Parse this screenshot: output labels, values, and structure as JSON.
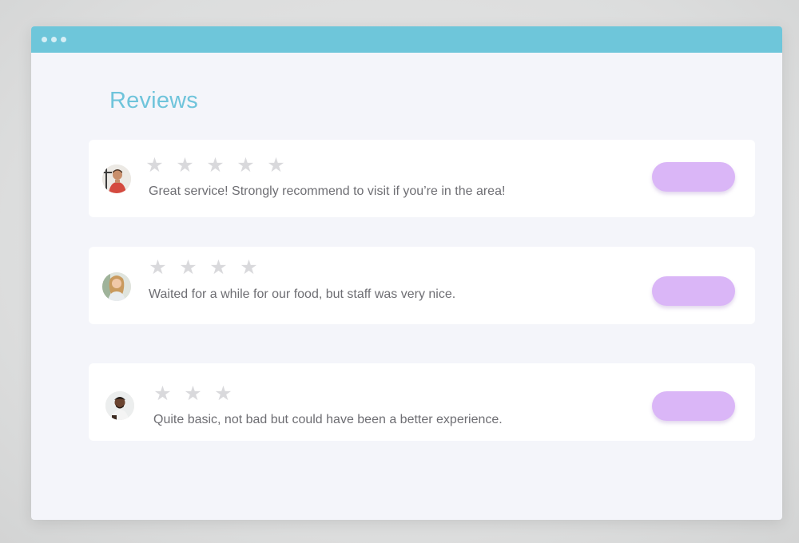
{
  "window": {
    "title_heading": "Reviews"
  },
  "reviews": [
    {
      "rating": 5,
      "text": "Great service! Strongly recommend to visit if you’re in the area!",
      "avatar_icon": "person-avatar-icon"
    },
    {
      "rating": 4,
      "text": "Waited for a while for our food, but staff was very nice.",
      "avatar_icon": "person-avatar-icon"
    },
    {
      "rating": 3,
      "text": "Quite basic, not bad but could have been a better experience.",
      "avatar_icon": "person-avatar-icon"
    }
  ],
  "colors": {
    "titlebar": "#6ec6da",
    "heading": "#6fc4db",
    "star": "#d9d9dc",
    "pill_button": "#dab6f7",
    "card": "#ffffff",
    "window_bg": "#f4f5fa"
  }
}
